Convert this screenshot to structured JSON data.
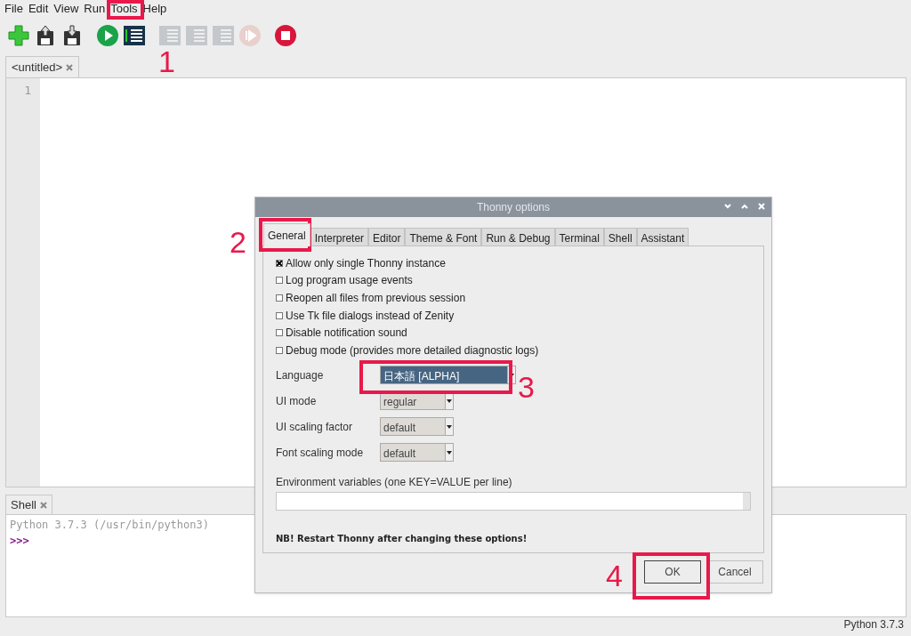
{
  "menu": [
    "File",
    "Edit",
    "View",
    "Run",
    "Tools",
    "Help"
  ],
  "toolbar": [
    {
      "kind": "new",
      "disabled": false
    },
    {
      "kind": "load",
      "disabled": false
    },
    {
      "kind": "save",
      "disabled": false
    },
    {
      "kind": "run",
      "disabled": false
    },
    {
      "kind": "debug",
      "disabled": false
    },
    {
      "kind": "stepover",
      "disabled": true
    },
    {
      "kind": "stepinto",
      "disabled": true
    },
    {
      "kind": "stepout",
      "disabled": true
    },
    {
      "kind": "resume",
      "disabled": true
    },
    {
      "kind": "stop",
      "disabled": false
    }
  ],
  "editor": {
    "tab": "<untitled>",
    "line_numbers": [
      "1"
    ]
  },
  "dialog": {
    "title": "Thonny options",
    "tabs": [
      {
        "label": "General",
        "selected": true
      },
      {
        "label": "Interpreter",
        "selected": false
      },
      {
        "label": "Editor",
        "selected": false
      },
      {
        "label": "Theme & Font",
        "selected": false
      },
      {
        "label": "Run & Debug",
        "selected": false
      },
      {
        "label": "Terminal",
        "selected": false
      },
      {
        "label": "Shell",
        "selected": false
      },
      {
        "label": "Assistant",
        "selected": false
      }
    ],
    "checkboxes": [
      {
        "label": "Allow only single Thonny instance",
        "checked": true
      },
      {
        "label": "Log program usage events",
        "checked": false
      },
      {
        "label": "Reopen all files from previous session",
        "checked": false
      },
      {
        "label": "Use Tk file dialogs instead of Zenity",
        "checked": false
      },
      {
        "label": "Disable notification sound",
        "checked": false
      },
      {
        "label": "Debug mode (provides more detailed diagnostic logs)",
        "checked": false
      }
    ],
    "selects": [
      {
        "label": "Language",
        "value": "日本語  [ALPHA]",
        "selected": true
      },
      {
        "label": "UI mode",
        "value": "regular",
        "selected": false
      },
      {
        "label": "UI scaling factor",
        "value": "default",
        "selected": false
      },
      {
        "label": "Font scaling mode",
        "value": "default",
        "selected": false
      }
    ],
    "env_label": "Environment variables (one KEY=VALUE per line)",
    "note": "NB! Restart Thonny after changing these options!",
    "buttons": [
      {
        "label": "OK",
        "selected": true
      },
      {
        "label": "Cancel",
        "selected": false
      }
    ]
  },
  "shell": {
    "tab": "Shell",
    "banner": "Python 3.7.3 (/usr/bin/python3)",
    "prompt": ">>>"
  },
  "status_bar": "Python 3.7.3",
  "annotations": [
    "1",
    "2",
    "3",
    "4"
  ]
}
